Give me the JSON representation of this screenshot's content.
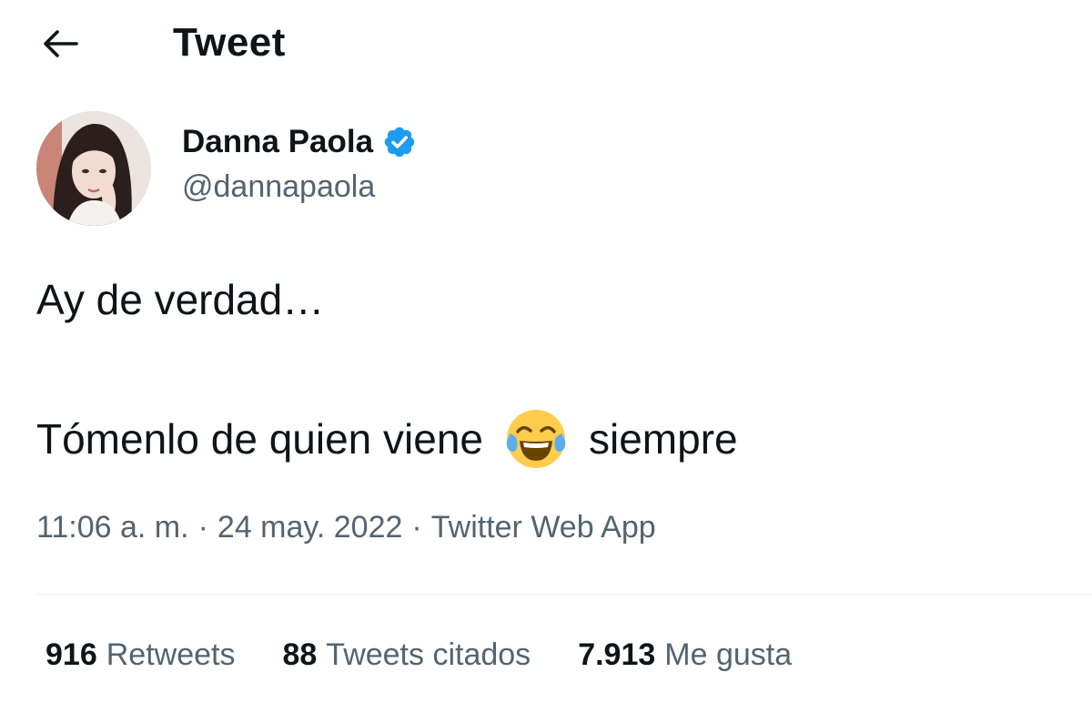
{
  "header": {
    "title": "Tweet",
    "back_icon": "arrow-left-icon"
  },
  "author": {
    "name": "Danna Paola",
    "handle": "@dannapaola",
    "verified": true,
    "verified_color": "#1d9bf0"
  },
  "tweet": {
    "line1": "Ay de verdad…",
    "line2_before": "Tómenlo de quien viene",
    "emoji_icon": "face-with-tears-of-joy-icon",
    "line2_after": "siempre"
  },
  "meta": {
    "time": "11:06 a. m.",
    "separator": "·",
    "date": "24 may. 2022",
    "source": "Twitter Web App"
  },
  "stats": {
    "retweets": {
      "count": "916",
      "label": "Retweets"
    },
    "quotes": {
      "count": "88",
      "label": "Tweets citados"
    },
    "likes": {
      "count": "7.913",
      "label": "Me gusta"
    }
  },
  "colors": {
    "text_primary": "#0f1419",
    "text_secondary": "#536471",
    "divider": "#eff3f4"
  }
}
